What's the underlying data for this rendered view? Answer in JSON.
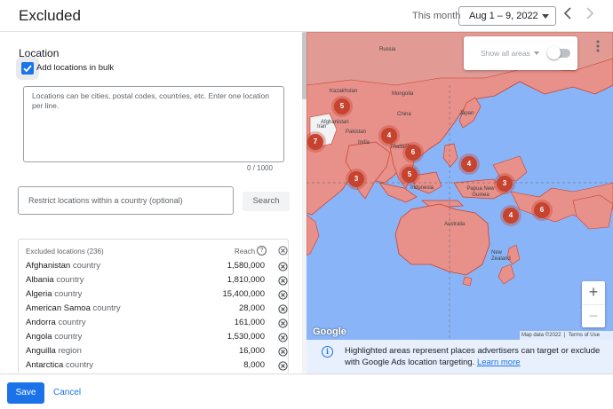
{
  "header": {
    "title": "Excluded",
    "period_label": "This month",
    "date_range": "Aug 1 – 9, 2022",
    "prev_icon": "chevron-left-icon",
    "next_icon": "chevron-right-icon"
  },
  "location": {
    "section_title": "Location",
    "bulk_label": "Add locations in bulk",
    "bulk_checked": true,
    "bulk_placeholder": "Locations can be cities, postal codes, countries, etc. Enter one location per line.",
    "char_count": "0 / 1000",
    "restrict_placeholder": "Restrict locations within a country (optional)",
    "search_label": "Search"
  },
  "excluded": {
    "header": "Excluded locations (236)",
    "reach_header": "Reach",
    "help_icon": "help-circle-icon",
    "remove_icon": "close-circle-icon",
    "items": [
      {
        "name": "Afghanistan",
        "type": "country",
        "reach": "1,580,000"
      },
      {
        "name": "Albania",
        "type": "country",
        "reach": "1,810,000"
      },
      {
        "name": "Algeria",
        "type": "country",
        "reach": "15,400,000"
      },
      {
        "name": "American Samoa",
        "type": "country",
        "reach": "28,000"
      },
      {
        "name": "Andorra",
        "type": "country",
        "reach": "161,000"
      },
      {
        "name": "Angola",
        "type": "country",
        "reach": "1,530,000"
      },
      {
        "name": "Anguilla",
        "type": "region",
        "reach": "16,000"
      },
      {
        "name": "Antarctica",
        "type": "country",
        "reach": "8,000"
      }
    ]
  },
  "map": {
    "toggle_label": "Show all areas",
    "toggle_on": false,
    "labels": [
      "Russia",
      "Kazakhstan",
      "Mongolia",
      "Afghanistan",
      "Iran",
      "Pakistan",
      "China",
      "Japan",
      "India",
      "Thailand",
      "Indonesia",
      "Papua New Guinea",
      "Australia",
      "New Zealand"
    ],
    "clusters": [
      "5",
      "7",
      "4",
      "6",
      "3",
      "5",
      "4",
      "3",
      "4",
      "6"
    ],
    "zoom_in": "+",
    "zoom_out": "−",
    "google": "Google",
    "attribution_data": "Map data ©2022",
    "attribution_terms": "Terms of Use",
    "colors": {
      "water": "#8ab4f8",
      "excluded": "#e8908a",
      "border": "#c5432f"
    }
  },
  "info": {
    "icon": "info-icon",
    "text": "Highlighted areas represent places advertisers can target or exclude with Google Ads location targeting.",
    "link": "Learn more"
  },
  "footer": {
    "save": "Save",
    "cancel": "Cancel"
  }
}
